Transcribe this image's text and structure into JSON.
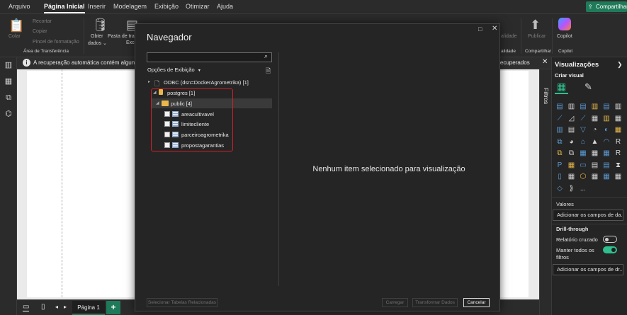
{
  "menubar": {
    "tabs": [
      "Arquivo",
      "Página Inicial",
      "Inserir",
      "Modelagem",
      "Exibição",
      "Otimizar",
      "Ajuda"
    ],
    "active_tab": "Página Inicial",
    "share_label": "Compartilhar"
  },
  "ribbon": {
    "colar": "Colar",
    "recortar": "Recortar",
    "copiar": "Copiar",
    "pincel": "Pincel de formatação",
    "clipboard_group": "Área de Transferência",
    "obter_dados": "Obter",
    "obter_dados_2": "dados ⌄",
    "pasta_de_trabalho": "Pasta de tral",
    "excel": "Exce",
    "alidade": "alidade",
    "alidade2": "alidade",
    "publicar": "Publicar",
    "compartilhar_group": "Compartilhar",
    "copilot": "Copilot",
    "copilot_group": "Copilot"
  },
  "infobar": {
    "message": "A recuperação automática contém alguns arqu",
    "recovered": "s recuperados"
  },
  "dialog": {
    "title": "Navegador",
    "display_options": "Opções de Exibição",
    "tree": {
      "odbc": "ODBC (dsn=DockerAgrometrika) [1]",
      "postgres": "postgres [1]",
      "public": "public [4]",
      "tables": [
        "areacultivavel",
        "limitecliente",
        "parceiroagrometrika",
        "propostagarantias"
      ]
    },
    "empty_message": "Nenhum item selecionado para visualização",
    "buttons": {
      "related": "Selecionar Tabelas Relacionadas",
      "load": "Carregar",
      "transform": "Transformar Dados",
      "cancel": "Cancelar"
    }
  },
  "filters_pane": {
    "label": "Filtros"
  },
  "visualizations": {
    "title": "Visualizações",
    "build_visual": "Criar visual",
    "values_label": "Valores",
    "add_fields_1": "Adicionar os campos de da...",
    "drillthrough": "Drill-through",
    "cross_report": "Relatório cruzado",
    "keep_filters_1": "Manter todos os",
    "keep_filters_2": "filtros",
    "add_fields_2": "Adicionar os campos de dr...",
    "more": "..."
  },
  "bottombar": {
    "page_tab": "Página 1",
    "add_page": "+"
  },
  "colors": {
    "accent_green": "#1f7a5a",
    "highlight_red": "#d0202a",
    "toggle_on": "#2fbf8f"
  }
}
